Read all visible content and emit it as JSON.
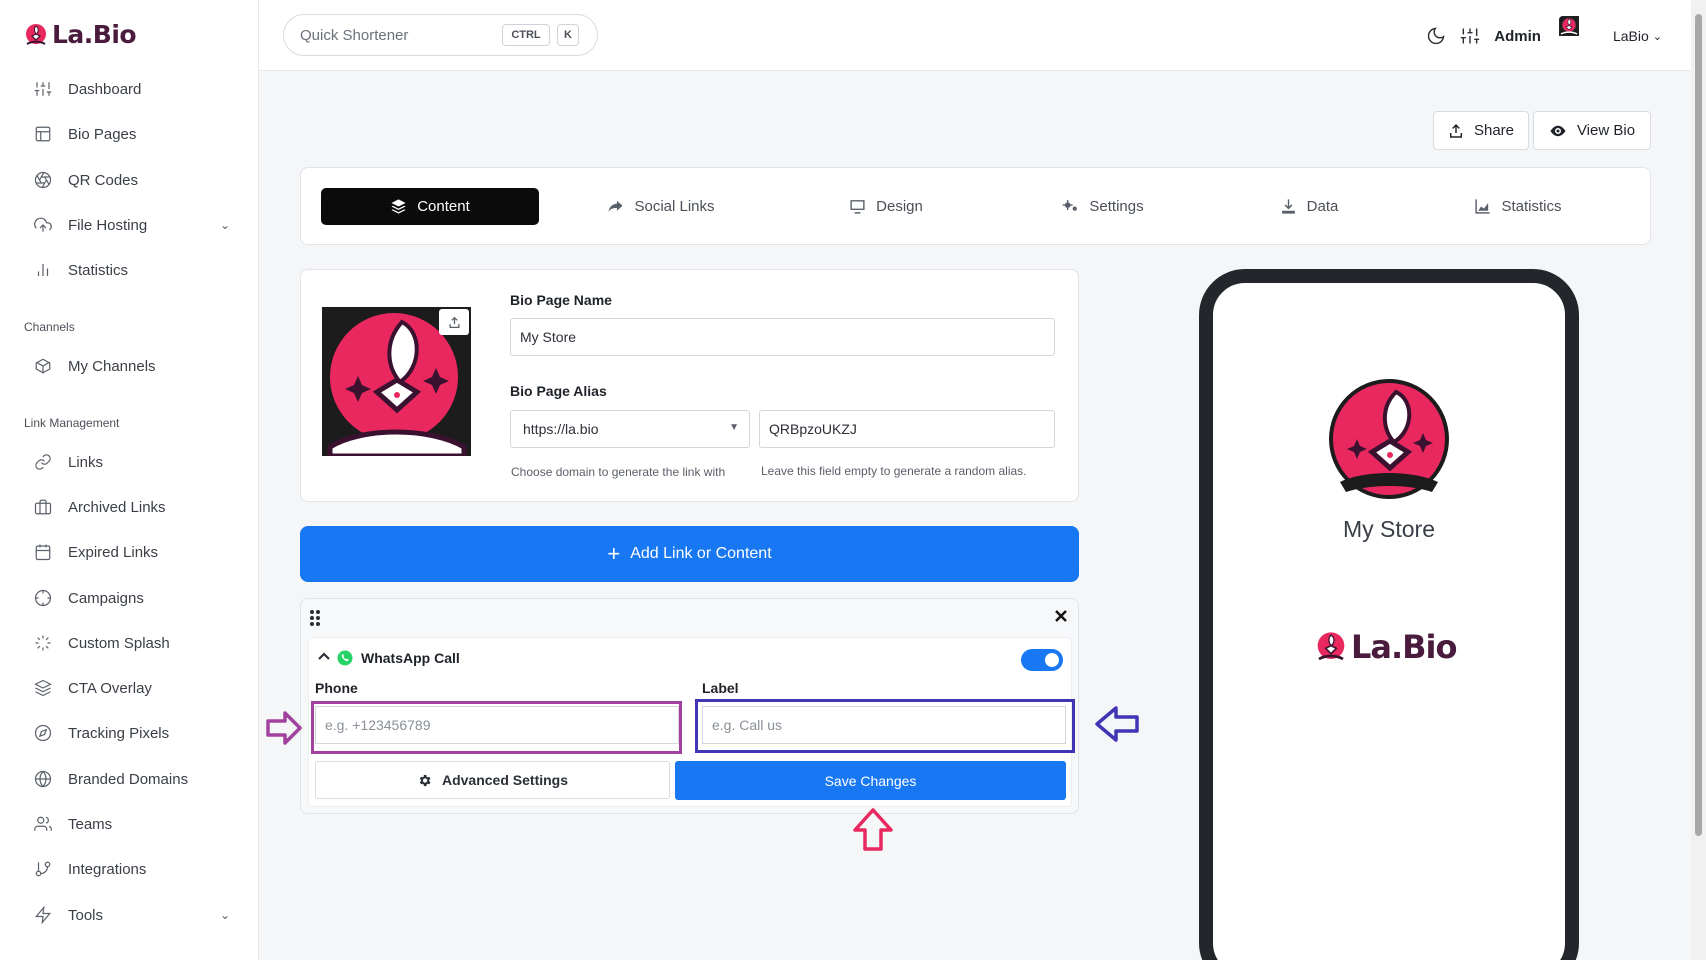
{
  "brand": {
    "name": "La.Bio",
    "color": "#4a1b3c",
    "accent": "#e8285f"
  },
  "sidebar": {
    "items": [
      {
        "label": "Dashboard",
        "icon": "sliders-icon"
      },
      {
        "label": "Bio Pages",
        "icon": "layout-icon"
      },
      {
        "label": "QR Codes",
        "icon": "aperture-icon"
      },
      {
        "label": "File Hosting",
        "icon": "upload-cloud-icon"
      },
      {
        "label": "Statistics",
        "icon": "bar-chart-icon"
      }
    ],
    "channels_heading": "Channels",
    "channels": [
      {
        "label": "My Channels",
        "icon": "box-icon"
      }
    ],
    "link_heading": "Link Management",
    "links": [
      {
        "label": "Links",
        "icon": "link-icon"
      },
      {
        "label": "Archived Links",
        "icon": "briefcase-icon"
      },
      {
        "label": "Expired Links",
        "icon": "calendar-icon"
      },
      {
        "label": "Campaigns",
        "icon": "crosshair-icon"
      },
      {
        "label": "Custom Splash",
        "icon": "loader-icon"
      },
      {
        "label": "CTA Overlay",
        "icon": "layers-icon"
      },
      {
        "label": "Tracking Pixels",
        "icon": "compass-icon"
      },
      {
        "label": "Branded Domains",
        "icon": "globe-icon"
      },
      {
        "label": "Teams",
        "icon": "users-icon"
      },
      {
        "label": "Integrations",
        "icon": "git-branch-icon"
      },
      {
        "label": "Tools",
        "icon": "zap-icon"
      }
    ]
  },
  "topbar": {
    "search_placeholder": "Quick Shortener",
    "kbd_ctrl": "CTRL",
    "kbd_k": "K",
    "admin_label": "Admin",
    "user_name": "LaBio"
  },
  "actions": {
    "share": "Share",
    "view_bio": "View Bio"
  },
  "tabs": [
    "Content",
    "Social Links",
    "Design",
    "Settings",
    "Data",
    "Statistics"
  ],
  "profile": {
    "name_label": "Bio Page Name",
    "name_value": "My Store",
    "alias_label": "Bio Page Alias",
    "domain_value": "https://la.bio",
    "alias_value": "QRBpzoUKZJ",
    "domain_hint": "Choose domain to generate the link with",
    "alias_hint": "Leave this field empty to generate a random alias."
  },
  "add_button": "Add Link or Content",
  "block": {
    "title": "WhatsApp Call",
    "phone_label": "Phone",
    "phone_placeholder": "e.g. +123456789",
    "label_label": "Label",
    "label_placeholder": "e.g. Call us",
    "advanced": "Advanced Settings",
    "save": "Save Changes",
    "enabled": true
  },
  "preview": {
    "store_name": "My Store",
    "brand": "La.Bio"
  },
  "colors": {
    "primary": "#1877f2",
    "phone_highlight": "#a2429e",
    "label_highlight": "#3f35b5",
    "save_arrow": "#e8285f"
  }
}
